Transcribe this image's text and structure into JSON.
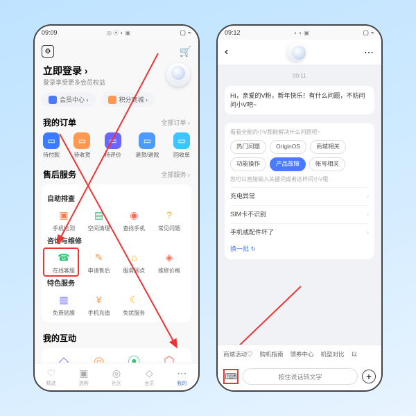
{
  "left": {
    "status": {
      "time": "09:09",
      "icons": "◎ ⦿ ◐ ▣",
      "right": "▢ ⌁"
    },
    "header": {
      "login_title": "立即登录 ›",
      "login_sub": "登录享受更多会员权益"
    },
    "pills": {
      "a": "会员中心 ›",
      "b": "积分商城 ›"
    },
    "orders": {
      "title": "我的订单",
      "more": "全部订单 ›",
      "items": [
        "待付款",
        "待收货",
        "待评价",
        "退货/退款",
        "回收单"
      ],
      "colors": [
        "#3a7bff",
        "#ff9850",
        "#6b66ff",
        "#4e9bff",
        "#40c4ff"
      ]
    },
    "after": {
      "title": "售后服务",
      "more": "全部服务 ›",
      "g1": "自助排查",
      "g1_items": [
        "手机检测",
        "空间清理",
        "查找手机",
        "常见问题"
      ],
      "g1_colors": [
        "#ff7a45",
        "#34c27a",
        "#ff6b57",
        "#ffb020"
      ],
      "g1_glyph": [
        "▣",
        "▤",
        "◉",
        "?"
      ],
      "g2": "咨询与维修",
      "g2_items": [
        "在线客服",
        "申请售后",
        "服务网点",
        "维修价格"
      ],
      "g2_colors": [
        "#34c27a",
        "#ff9850",
        "#ffb020",
        "#ff6b57"
      ],
      "g2_glyph": [
        "☎",
        "✎",
        "⌂",
        "◈"
      ],
      "g3": "特色服务",
      "g3_items": [
        "免费贴膜",
        "手机充值",
        "免扰服务",
        ""
      ],
      "g3_colors": [
        "#6b66ff",
        "#ff9850",
        "#ffb020",
        ""
      ],
      "g3_glyph": [
        "▥",
        "¥",
        "☾",
        ""
      ]
    },
    "interact": {
      "title": "我的互动",
      "colors": [
        "#8a6bff",
        "#ff9850",
        "#34c27a",
        "#ff6b57"
      ],
      "glyph": [
        "◇",
        "◎",
        "⦿",
        "⬡"
      ]
    },
    "nav": [
      "精选",
      "选购",
      "社区",
      "会员",
      "我的"
    ],
    "nav_glyph": [
      "♡",
      "▣",
      "◎",
      "◇",
      "⋯"
    ]
  },
  "right": {
    "status": {
      "time": "09:12",
      "icons": "◐ ◐ ▣",
      "right": "▢ ⌁"
    },
    "chat": {
      "time": "09:11",
      "greeting": "Hi，亲爱的V粉，新年快乐！有什么问题，不妨问问小V吧~",
      "cat_header": "看看全能的小V都能解决什么问题吧~",
      "cats": [
        "热门问题",
        "OriginOS",
        "商城相关",
        "功能操作",
        "产品故障",
        "帐号相关"
      ],
      "hint": "您可以直接输入关键词或者这样问小V哦",
      "items": [
        "充电异常",
        "SIM卡不识别",
        "手机或配件坏了"
      ],
      "refresh": "换一批 ↻"
    },
    "suggest": [
      "商城活动♡",
      "购机指南",
      "领券中心",
      "机型对比",
      "以"
    ],
    "input": {
      "placeholder": "按住说话转文字"
    }
  }
}
